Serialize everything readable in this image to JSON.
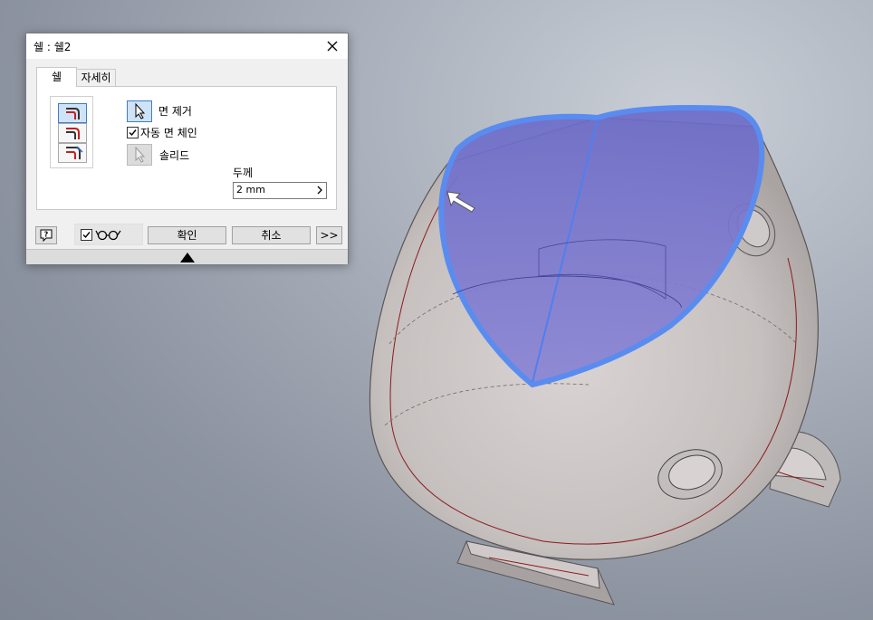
{
  "dialog": {
    "title": "쉘 : 쉘2",
    "tabs": [
      {
        "label": "쉘"
      },
      {
        "label": "자세히"
      }
    ],
    "remove_faces_label": "면 제거",
    "auto_face_chain_label": "자동 면 체인",
    "auto_face_chain_checked": true,
    "solid_label": "솔리드",
    "thickness_label": "두께",
    "thickness_value": "2 mm",
    "ok_label": "확인",
    "cancel_label": "취소",
    "more_label": ">>",
    "preview_checked": true
  },
  "colors": {
    "selected_face": "#6f6fd0",
    "selection_outline": "#5a8cf0",
    "model_body": "#c9c4c4",
    "edge_red": "#8b1a1a",
    "background": "#8f97a4"
  },
  "icons": [
    "close-icon",
    "help-icon",
    "glasses-icon",
    "checkmark-icon",
    "cursor-icon",
    "collapse-triangle-icon"
  ]
}
